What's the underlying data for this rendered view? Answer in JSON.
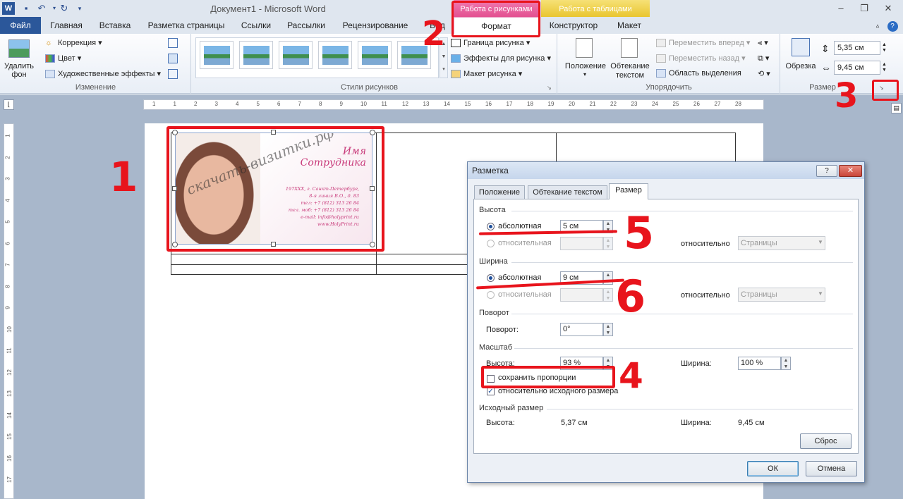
{
  "titlebar": {
    "title": "Документ1  -  Microsoft Word",
    "ctx_pictures": "Работа с рисунками",
    "ctx_tables": "Работа с таблицами"
  },
  "tabs": {
    "file": "Файл",
    "home": "Главная",
    "insert": "Вставка",
    "layout": "Разметка страницы",
    "refs": "Ссылки",
    "mail": "Рассылки",
    "review": "Рецензирование",
    "view": "Вид",
    "format": "Формат",
    "design": "Конструктор",
    "layout2": "Макет"
  },
  "ribbon": {
    "remove_bg": "Удалить фон",
    "correction": "Коррекция",
    "color": "Цвет",
    "artistic": "Художественные эффекты",
    "grp_change": "Изменение",
    "grp_styles": "Стили рисунков",
    "border": "Граница рисунка",
    "effects": "Эффекты для рисунка",
    "pic_layout": "Макет рисунка",
    "position": "Положение",
    "wrap": "Обтекание текстом",
    "forward": "Переместить вперед",
    "backward": "Переместить назад",
    "selection": "Область выделения",
    "grp_arrange": "Упорядочить",
    "crop": "Обрезка",
    "height": "5,35 см",
    "width": "9,45 см",
    "grp_size": "Размер"
  },
  "card": {
    "name": "Имя",
    "surname": "Сотрудника",
    "address1": "197ХХХ, г. Санкт-Петербург,",
    "address2": "8-я линия В.О., д. 83",
    "tel": "тел: +7 (812) 313 26 84",
    "mob": "тел. моб: +7 (812) 313 26 84",
    "email": "e-mail: info@holyprint.ru",
    "web": "www.HolyPrint.ru",
    "watermark": "скачать-визитки.рф"
  },
  "dialog": {
    "title": "Разметка",
    "help": "?",
    "tab_position": "Положение",
    "tab_wrap": "Обтекание текстом",
    "tab_size": "Размер",
    "height_section": "Высота",
    "absolute": "абсолютная",
    "height_abs": "5 см",
    "relative": "относительная",
    "relative_to": "относительно",
    "page": "Страницы",
    "width_section": "Ширина",
    "width_abs": "9 см",
    "rotation_section": "Поворот",
    "rotation_label": "Поворот:",
    "rotation_value": "0°",
    "scale_section": "Масштаб",
    "scale_height_label": "Высота:",
    "scale_height": "93 %",
    "scale_width_label": "Ширина:",
    "scale_width": "100 %",
    "lock_aspect": "сохранить пропорции",
    "relative_original": "относительно исходного размера",
    "original_section": "Исходный размер",
    "orig_height_label": "Высота:",
    "orig_height": "5,37 см",
    "orig_width_label": "Ширина:",
    "orig_width": "9,45 см",
    "reset": "Сброс",
    "ok": "ОК",
    "cancel": "Отмена"
  },
  "annotations": {
    "n1": "1",
    "n2": "2",
    "n3": "3",
    "n4": "4",
    "n5": "5",
    "n6": "6"
  },
  "ruler": {
    "h": [
      "1",
      "1",
      "2",
      "3",
      "4",
      "5",
      "6",
      "7",
      "8",
      "9",
      "10",
      "11",
      "12",
      "13",
      "14",
      "15",
      "16",
      "17",
      "18",
      "19",
      "20",
      "21",
      "22",
      "23",
      "24",
      "25",
      "26",
      "27",
      "28"
    ],
    "v": [
      "1",
      "2",
      "3",
      "4",
      "5",
      "6",
      "7",
      "8",
      "9",
      "10",
      "11",
      "12",
      "13",
      "14",
      "15",
      "16",
      "17"
    ]
  },
  "colors": {
    "accent": "#2b579a",
    "pictures_tab": "#e24d8e",
    "tables_tab": "#e8c32a",
    "annotation": "#e8141c"
  }
}
